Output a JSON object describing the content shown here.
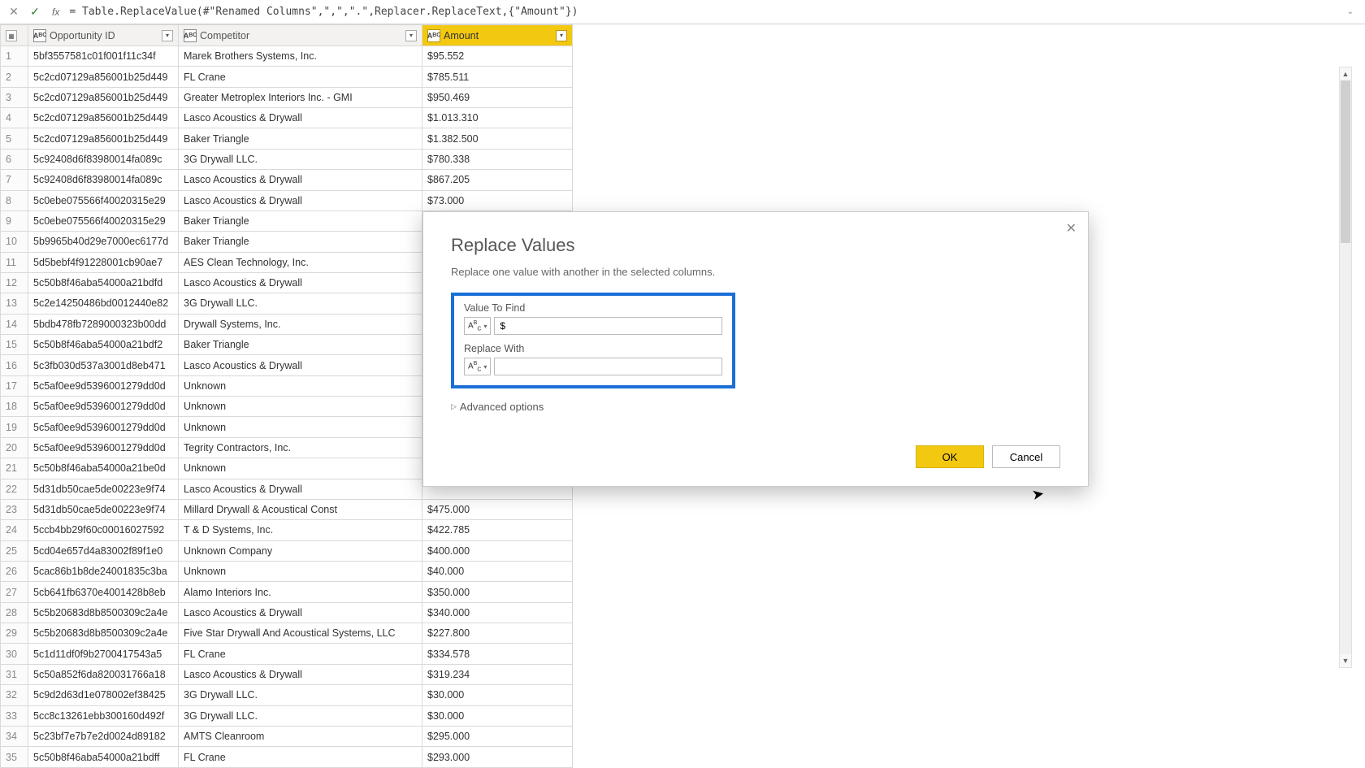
{
  "formula_bar": {
    "fx_label": "fx",
    "formula": "= Table.ReplaceValue(#\"Renamed Columns\",\",\",\".\",Replacer.ReplaceText,{\"Amount\"})"
  },
  "columns": {
    "opp": "Opportunity ID",
    "comp": "Competitor",
    "amt": "Amount"
  },
  "rows": [
    {
      "n": "1",
      "opp": "5bf3557581c01f001f11c34f",
      "comp": "Marek Brothers Systems, Inc.",
      "amt": "$95.552"
    },
    {
      "n": "2",
      "opp": "5c2cd07129a856001b25d449",
      "comp": "FL Crane",
      "amt": "$785.511"
    },
    {
      "n": "3",
      "opp": "5c2cd07129a856001b25d449",
      "comp": "Greater Metroplex Interiors  Inc. - GMI",
      "amt": "$950.469"
    },
    {
      "n": "4",
      "opp": "5c2cd07129a856001b25d449",
      "comp": "Lasco Acoustics & Drywall",
      "amt": "$1.013.310"
    },
    {
      "n": "5",
      "opp": "5c2cd07129a856001b25d449",
      "comp": "Baker Triangle",
      "amt": "$1.382.500"
    },
    {
      "n": "6",
      "opp": "5c92408d6f83980014fa089c",
      "comp": "3G Drywall LLC.",
      "amt": "$780.338"
    },
    {
      "n": "7",
      "opp": "5c92408d6f83980014fa089c",
      "comp": "Lasco Acoustics & Drywall",
      "amt": "$867.205"
    },
    {
      "n": "8",
      "opp": "5c0ebe075566f40020315e29",
      "comp": "Lasco Acoustics & Drywall",
      "amt": "$73.000"
    },
    {
      "n": "9",
      "opp": "5c0ebe075566f40020315e29",
      "comp": "Baker Triangle",
      "amt": ""
    },
    {
      "n": "10",
      "opp": "5b9965b40d29e7000ec6177d",
      "comp": "Baker Triangle",
      "amt": ""
    },
    {
      "n": "11",
      "opp": "5d5bebf4f91228001cb90ae7",
      "comp": "AES Clean Technology, Inc.",
      "amt": ""
    },
    {
      "n": "12",
      "opp": "5c50b8f46aba54000a21bdfd",
      "comp": "Lasco Acoustics & Drywall",
      "amt": ""
    },
    {
      "n": "13",
      "opp": "5c2e14250486bd0012440e82",
      "comp": "3G Drywall LLC.",
      "amt": ""
    },
    {
      "n": "14",
      "opp": "5bdb478fb7289000323b00dd",
      "comp": "Drywall Systems, Inc.",
      "amt": ""
    },
    {
      "n": "15",
      "opp": "5c50b8f46aba54000a21bdf2",
      "comp": "Baker Triangle",
      "amt": ""
    },
    {
      "n": "16",
      "opp": "5c3fb030d537a3001d8eb471",
      "comp": "Lasco Acoustics & Drywall",
      "amt": ""
    },
    {
      "n": "17",
      "opp": "5c5af0ee9d5396001279dd0d",
      "comp": "Unknown",
      "amt": ""
    },
    {
      "n": "18",
      "opp": "5c5af0ee9d5396001279dd0d",
      "comp": "Unknown",
      "amt": ""
    },
    {
      "n": "19",
      "opp": "5c5af0ee9d5396001279dd0d",
      "comp": "Unknown",
      "amt": ""
    },
    {
      "n": "20",
      "opp": "5c5af0ee9d5396001279dd0d",
      "comp": "Tegrity Contractors, Inc.",
      "amt": ""
    },
    {
      "n": "21",
      "opp": "5c50b8f46aba54000a21be0d",
      "comp": "Unknown",
      "amt": ""
    },
    {
      "n": "22",
      "opp": "5d31db50cae5de00223e9f74",
      "comp": "Lasco Acoustics & Drywall",
      "amt": ""
    },
    {
      "n": "23",
      "opp": "5d31db50cae5de00223e9f74",
      "comp": "Millard Drywall & Acoustical Const",
      "amt": "$475.000"
    },
    {
      "n": "24",
      "opp": "5ccb4bb29f60c00016027592",
      "comp": "T & D Systems, Inc.",
      "amt": "$422.785"
    },
    {
      "n": "25",
      "opp": "5cd04e657d4a83002f89f1e0",
      "comp": "Unknown Company",
      "amt": "$400.000"
    },
    {
      "n": "26",
      "opp": "5cac86b1b8de24001835c3ba",
      "comp": "Unknown",
      "amt": "$40.000"
    },
    {
      "n": "27",
      "opp": "5cb641fb6370e4001428b8eb",
      "comp": "Alamo Interiors Inc.",
      "amt": "$350.000"
    },
    {
      "n": "28",
      "opp": "5c5b20683d8b8500309c2a4e",
      "comp": "Lasco Acoustics & Drywall",
      "amt": "$340.000"
    },
    {
      "n": "29",
      "opp": "5c5b20683d8b8500309c2a4e",
      "comp": "Five Star Drywall And Acoustical Systems, LLC",
      "amt": "$227.800"
    },
    {
      "n": "30",
      "opp": "5c1d11df0f9b270041‍7543a5",
      "comp": "FL Crane",
      "amt": "$334.578"
    },
    {
      "n": "31",
      "opp": "5c50a852f6da820031766a18",
      "comp": "Lasco Acoustics & Drywall",
      "amt": "$319.234"
    },
    {
      "n": "32",
      "opp": "5c9d2d63d1e078002ef38425",
      "comp": "3G Drywall LLC.",
      "amt": "$30.000"
    },
    {
      "n": "33",
      "opp": "5cc8c13261ebb300160d492f",
      "comp": "3G Drywall LLC.",
      "amt": "$30.000"
    },
    {
      "n": "34",
      "opp": "5c23bf7e7b7e2d0024d89182",
      "comp": "AMTS Cleanroom",
      "amt": "$295.000"
    },
    {
      "n": "35",
      "opp": "5c50b8f46aba54000a21bdff",
      "comp": "FL Crane",
      "amt": "$293.000"
    }
  ],
  "dialog": {
    "title": "Replace Values",
    "subtitle": "Replace one value with another in the selected columns.",
    "find_label": "Value To Find",
    "find_value": "$",
    "replace_label": "Replace With",
    "replace_value": "",
    "advanced": "Advanced options",
    "ok": "OK",
    "cancel": "Cancel"
  }
}
